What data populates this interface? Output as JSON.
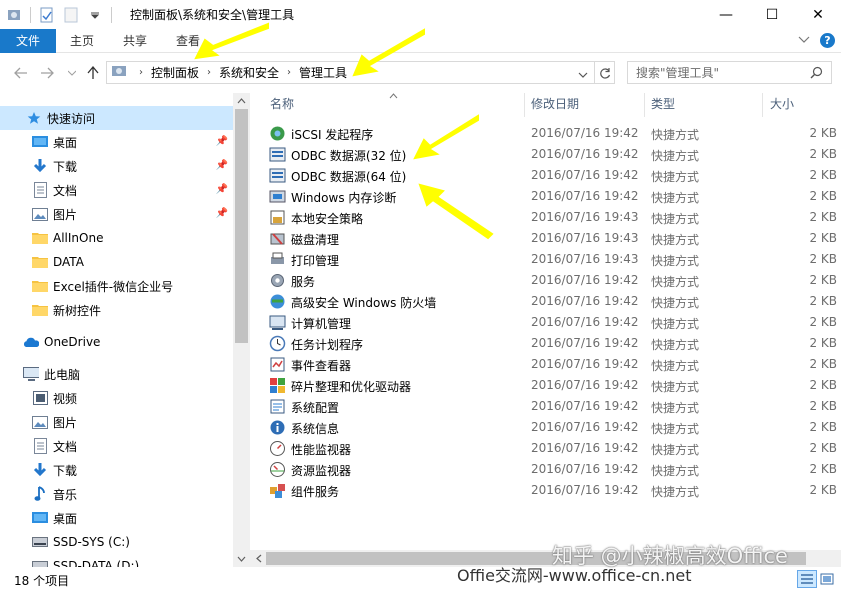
{
  "window": {
    "title": "控制面板\\系统和安全\\管理工具",
    "minimize": "—",
    "maximize": "☐",
    "close": "✕"
  },
  "ribbon": {
    "tabs": [
      "文件",
      "主页",
      "共享",
      "查看"
    ]
  },
  "address": {
    "crumbs": [
      "控制面板",
      "系统和安全",
      "管理工具"
    ]
  },
  "search": {
    "placeholder": "搜索\"管理工具\""
  },
  "columns": {
    "name": "名称",
    "date": "修改日期",
    "type": "类型",
    "size": "大小"
  },
  "sidebar": {
    "items": [
      {
        "label": "快速访问",
        "icon": "star-icon"
      },
      {
        "label": "桌面",
        "icon": "desktop-icon"
      },
      {
        "label": "下载",
        "icon": "download-icon"
      },
      {
        "label": "文档",
        "icon": "document-icon"
      },
      {
        "label": "图片",
        "icon": "pictures-icon"
      },
      {
        "label": "AllInOne",
        "icon": "folder-icon"
      },
      {
        "label": "DATA",
        "icon": "folder-icon"
      },
      {
        "label": "Excel插件-微信企业号",
        "icon": "folder-icon"
      },
      {
        "label": "新树控件",
        "icon": "folder-icon"
      },
      {
        "label": "OneDrive",
        "icon": "cloud-icon"
      },
      {
        "label": "此电脑",
        "icon": "computer-icon"
      },
      {
        "label": "视频",
        "icon": "video-icon"
      },
      {
        "label": "图片",
        "icon": "pictures-icon"
      },
      {
        "label": "文档",
        "icon": "document-icon"
      },
      {
        "label": "下载",
        "icon": "download-icon"
      },
      {
        "label": "音乐",
        "icon": "music-icon"
      },
      {
        "label": "桌面",
        "icon": "desktop-icon"
      },
      {
        "label": "SSD-SYS (C:)",
        "icon": "drive-icon"
      },
      {
        "label": "SSD-DATA (D:)",
        "icon": "drive-icon"
      }
    ]
  },
  "files": [
    {
      "name": "iSCSI 发起程序",
      "date": "2016/07/16 19:42",
      "type": "快捷方式",
      "size": "2 KB"
    },
    {
      "name": "ODBC 数据源(32 位)",
      "date": "2016/07/16 19:42",
      "type": "快捷方式",
      "size": "2 KB"
    },
    {
      "name": "ODBC 数据源(64 位)",
      "date": "2016/07/16 19:42",
      "type": "快捷方式",
      "size": "2 KB"
    },
    {
      "name": "Windows 内存诊断",
      "date": "2016/07/16 19:42",
      "type": "快捷方式",
      "size": "2 KB"
    },
    {
      "name": "本地安全策略",
      "date": "2016/07/16 19:43",
      "type": "快捷方式",
      "size": "2 KB"
    },
    {
      "name": "磁盘清理",
      "date": "2016/07/16 19:43",
      "type": "快捷方式",
      "size": "2 KB"
    },
    {
      "name": "打印管理",
      "date": "2016/07/16 19:43",
      "type": "快捷方式",
      "size": "2 KB"
    },
    {
      "name": "服务",
      "date": "2016/07/16 19:42",
      "type": "快捷方式",
      "size": "2 KB"
    },
    {
      "name": "高级安全 Windows 防火墙",
      "date": "2016/07/16 19:42",
      "type": "快捷方式",
      "size": "2 KB"
    },
    {
      "name": "计算机管理",
      "date": "2016/07/16 19:42",
      "type": "快捷方式",
      "size": "2 KB"
    },
    {
      "name": "任务计划程序",
      "date": "2016/07/16 19:42",
      "type": "快捷方式",
      "size": "2 KB"
    },
    {
      "name": "事件查看器",
      "date": "2016/07/16 19:42",
      "type": "快捷方式",
      "size": "2 KB"
    },
    {
      "name": "碎片整理和优化驱动器",
      "date": "2016/07/16 19:42",
      "type": "快捷方式",
      "size": "2 KB"
    },
    {
      "name": "系统配置",
      "date": "2016/07/16 19:42",
      "type": "快捷方式",
      "size": "2 KB"
    },
    {
      "name": "系统信息",
      "date": "2016/07/16 19:42",
      "type": "快捷方式",
      "size": "2 KB"
    },
    {
      "name": "性能监视器",
      "date": "2016/07/16 19:42",
      "type": "快捷方式",
      "size": "2 KB"
    },
    {
      "name": "资源监视器",
      "date": "2016/07/16 19:42",
      "type": "快捷方式",
      "size": "2 KB"
    },
    {
      "name": "组件服务",
      "date": "2016/07/16 19:42",
      "type": "快捷方式",
      "size": "2 KB"
    }
  ],
  "status": {
    "count": "18 个项目"
  },
  "watermark": {
    "line1": "知乎 @小辣椒高效Office",
    "line2": "Offie交流网-www.office-cn.net"
  },
  "colors": {
    "accent": "#1979ca",
    "selection": "#cce8ff",
    "annotation": "#ffff00"
  }
}
